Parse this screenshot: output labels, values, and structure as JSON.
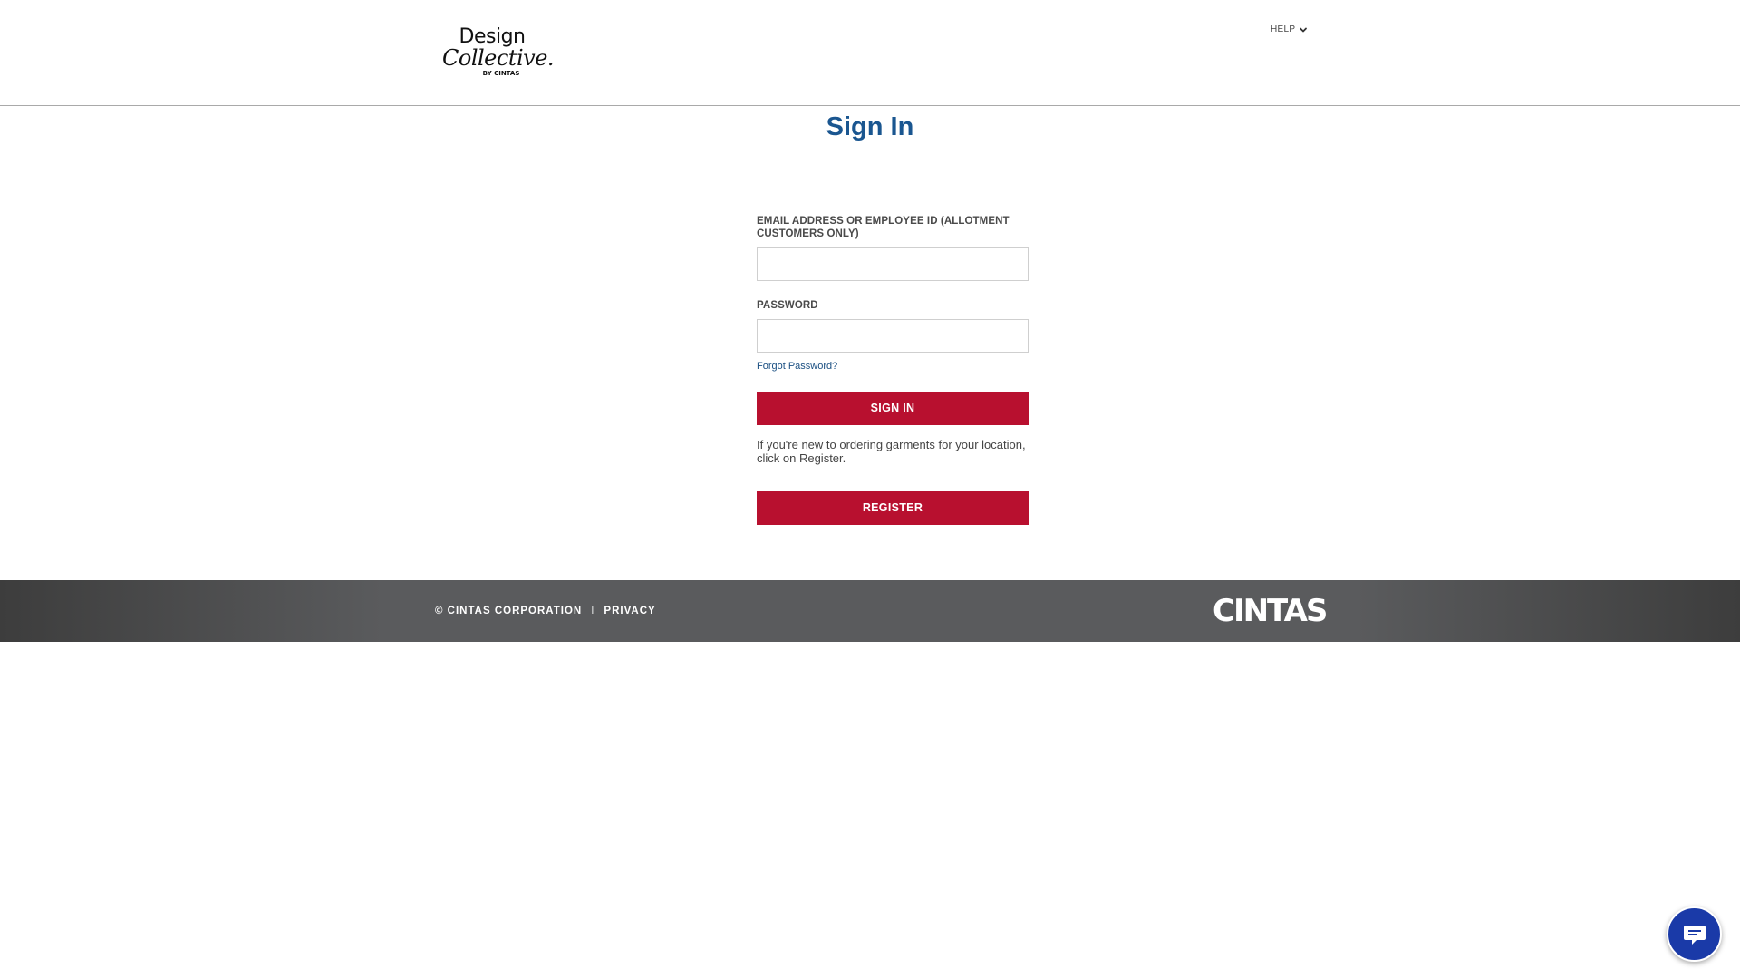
{
  "header": {
    "logo": {
      "line1": "Design",
      "line2": "Collective.",
      "line3": "BY CINTAS"
    },
    "help_label": "HELP"
  },
  "page_title": "Sign In",
  "form": {
    "email_label": "EMAIL ADDRESS OR EMPLOYEE ID (ALLOTMENT CUSTOMERS ONLY)",
    "email_value": "",
    "password_label": "PASSWORD",
    "password_value": "",
    "forgot_link": "Forgot Password?",
    "sign_in_label": "SIGN IN",
    "register_note": "If you're new to ordering garments for your location, click on Register.",
    "register_label": "REGISTER"
  },
  "footer": {
    "copyright": "© CINTAS CORPORATION",
    "separator": "I",
    "privacy_link": "PRIVACY",
    "brand_logo": "CINTAS"
  },
  "icons": {
    "help_chevron": "chevron-down-icon",
    "chat": "chat-bubble-icon"
  },
  "colors": {
    "title": "#1a5690",
    "primary_button": "#b8102f",
    "footer": "#5a5b5d",
    "chat_button": "#1a3aa8",
    "link": "#1a4f82"
  }
}
